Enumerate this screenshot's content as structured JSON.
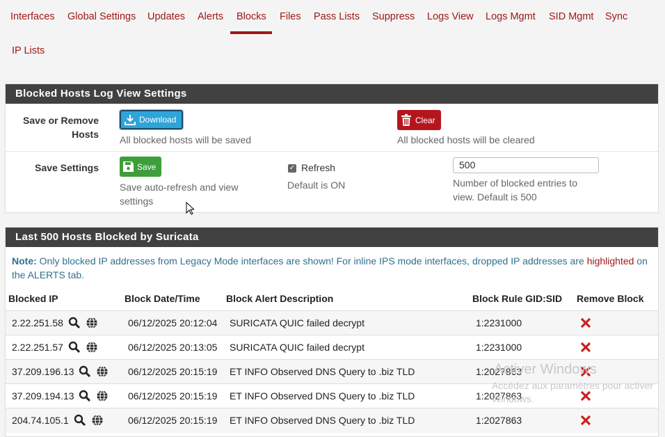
{
  "tabs": [
    "Interfaces",
    "Global Settings",
    "Updates",
    "Alerts",
    "Blocks",
    "Files",
    "Pass Lists",
    "Suppress",
    "Logs View",
    "Logs Mgmt",
    "SID Mgmt",
    "Sync",
    "IP Lists"
  ],
  "settings_panel": {
    "title": "Blocked Hosts Log View Settings",
    "save_remove_label_1": "Save or Remove",
    "save_remove_label_2": "Hosts",
    "download_label": "Download",
    "download_help": "All blocked hosts will be saved",
    "clear_label": "Clear",
    "clear_help": "All blocked hosts will be cleared",
    "save_settings_label": "Save Settings",
    "save_label": "Save",
    "save_help_1": "Save auto-refresh and view",
    "save_help_2": "settings",
    "refresh_label": "Refresh",
    "refresh_help": "Default is ON",
    "entries_value": "500",
    "entries_help_1": "Number of blocked entries to",
    "entries_help_2": "view. Default is 500"
  },
  "hosts_panel": {
    "title": "Last 500 Hosts Blocked by Suricata",
    "note_label": "Note:",
    "note_text": " Only blocked IP addresses from Legacy Mode interfaces are shown! For inline IPS mode interfaces, dropped IP addresses are ",
    "note_highlight": "highlighted",
    "note_tail": " on the ALERTS tab.",
    "columns": [
      "Blocked IP",
      "Block Date/Time",
      "Block Alert Description",
      "Block Rule GID:SID",
      "Remove Block"
    ],
    "rows": [
      {
        "ip": "2.22.251.58",
        "date": "06/12/2025 20:12:04",
        "desc": "SURICATA QUIC failed decrypt",
        "sid": "1:2231000"
      },
      {
        "ip": "2.22.251.57",
        "date": "06/12/2025 20:13:05",
        "desc": "SURICATA QUIC failed decrypt",
        "sid": "1:2231000"
      },
      {
        "ip": "37.209.196.13",
        "date": "06/12/2025 20:15:19",
        "desc": "ET INFO Observed DNS Query to .biz TLD",
        "sid": "1:2027863"
      },
      {
        "ip": "37.209.194.13",
        "date": "06/12/2025 20:15:19",
        "desc": "ET INFO Observed DNS Query to .biz TLD",
        "sid": "1:2027863"
      },
      {
        "ip": "204.74.105.1",
        "date": "06/12/2025 20:15:19",
        "desc": "ET INFO Observed DNS Query to .biz TLD",
        "sid": "1:2027863"
      }
    ]
  },
  "watermark": {
    "line1": "Activer Windows",
    "line2": "Accédez aux paramètres pour activer",
    "line3": "Windows."
  },
  "colors": {
    "accent": "#a01818",
    "panel_heading": "#414141",
    "info": "#2fa4d8",
    "danger": "#b5161d",
    "success": "#3e9e3b"
  }
}
